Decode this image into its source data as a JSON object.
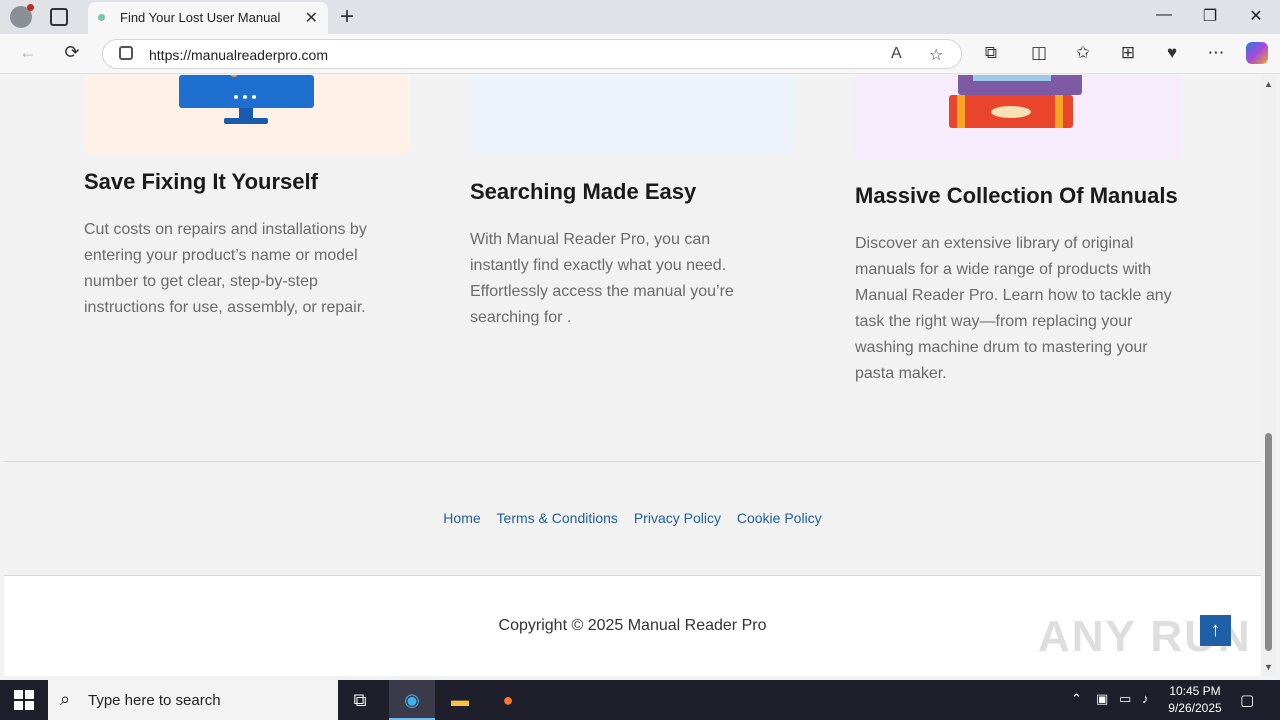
{
  "browser": {
    "tab_title": "Find Your Lost User Manual",
    "tab_close": "✕",
    "new_tab": "+",
    "url": "https://manualreaderpro.com",
    "window_controls": {
      "minimize": "—",
      "restore": "❐",
      "close": "✕"
    },
    "nav": {
      "back": "←",
      "refresh": "⟳"
    },
    "omnibox_icons": {
      "read_aloud": "A",
      "favorite": "☆"
    },
    "toolbar_icons": {
      "extensions": "⧉",
      "split": "◫",
      "favorites": "✩",
      "collections": "⊞",
      "browser_essentials": "♥",
      "more": "⋯"
    }
  },
  "features": [
    {
      "title": "Save Fixing It Yourself",
      "text": "Cut costs on repairs and installations by entering your product’s name or model number to get clear, step-by-step instructions for use, assembly, or repair."
    },
    {
      "title": "Searching Made Easy",
      "text": "With Manual Reader Pro, you can instantly find exactly what you need. Effortlessly access the manual you’re searching for ."
    },
    {
      "title": "Massive Collection Of Manuals",
      "text": "Discover an extensive library of original manuals for a wide range of products with Manual Reader Pro. Learn how to tackle any task the right way—from replacing your washing machine drum to mastering your pasta maker."
    }
  ],
  "footer": {
    "links": [
      "Home",
      "Terms & Conditions",
      "Privacy Policy",
      "Cookie Policy"
    ],
    "copyright": "Copyright © 2025 Manual Reader Pro",
    "to_top": "↑",
    "watermark": "ANY RUN"
  },
  "taskbar": {
    "search_placeholder": "Type here to search",
    "time": "10:45 PM",
    "date": "9/26/2025"
  },
  "colors": {
    "link": "#1f5fa8",
    "card1_bg": "#fdf1e8",
    "card2_bg": "#eef3fb",
    "card3_bg": "#f6ecfb"
  }
}
